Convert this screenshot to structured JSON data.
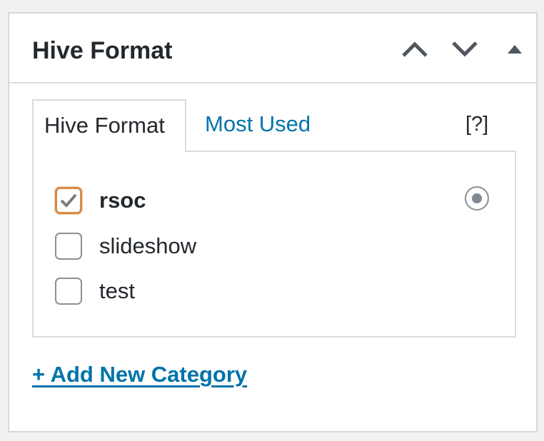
{
  "panel": {
    "title": "Hive Format",
    "controls": {
      "move_up": "chevron-up-icon",
      "move_down": "chevron-down-icon",
      "toggle": "triangle-up-icon"
    }
  },
  "tabs": {
    "active_label": "Hive Format",
    "secondary_label": "Most Used",
    "help_label": "[?]"
  },
  "categories": [
    {
      "label": "rsoc",
      "checked": true,
      "primary": true
    },
    {
      "label": "slideshow",
      "checked": false,
      "primary": false
    },
    {
      "label": "test",
      "checked": false,
      "primary": false
    }
  ],
  "add_new_label": "+ Add New Category",
  "colors": {
    "link": "#0073aa",
    "focus_border": "#d88a45",
    "text": "#23282d",
    "border": "#dcdcdc"
  }
}
